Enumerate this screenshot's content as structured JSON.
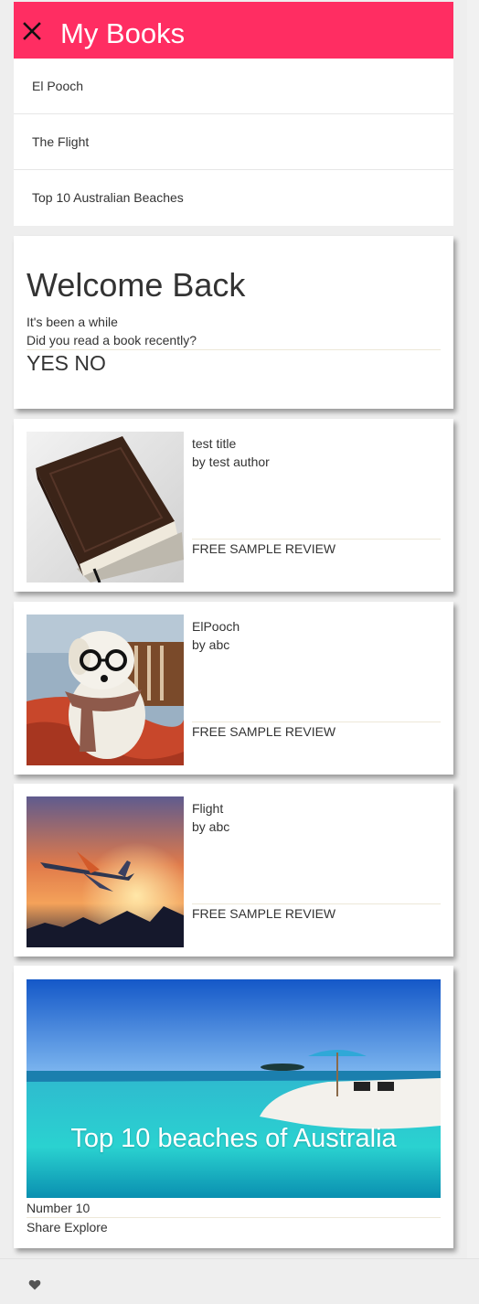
{
  "header": {
    "title": "My Books",
    "close_icon": "close-icon",
    "color": "#ff2d62"
  },
  "drawer": {
    "items": [
      {
        "label": "El Pooch"
      },
      {
        "label": "The Flight"
      },
      {
        "label": "Top 10 Australian Beaches"
      }
    ]
  },
  "welcome": {
    "title": "Welcome Back",
    "line1": "It's been a while",
    "line2": "Did you read a book recently?",
    "yes": "YES",
    "no": "NO"
  },
  "books": [
    {
      "title": "test title",
      "author": "by test author",
      "action": "FREE SAMPLE REVIEW",
      "image": "leather-book-image"
    },
    {
      "title": "ElPooch",
      "author": "by abc",
      "action": "FREE SAMPLE REVIEW",
      "image": "dog-with-glasses-image"
    },
    {
      "title": "Flight",
      "author": "by abc",
      "action": "FREE SAMPLE REVIEW",
      "image": "airplane-sunset-image"
    }
  ],
  "feature": {
    "hero_text": "Top 10 beaches of Australia",
    "subtitle": "Number 10",
    "share": "Share",
    "explore": "Explore",
    "image": "beach-image"
  },
  "footer": {
    "icon": "heart-icon"
  }
}
